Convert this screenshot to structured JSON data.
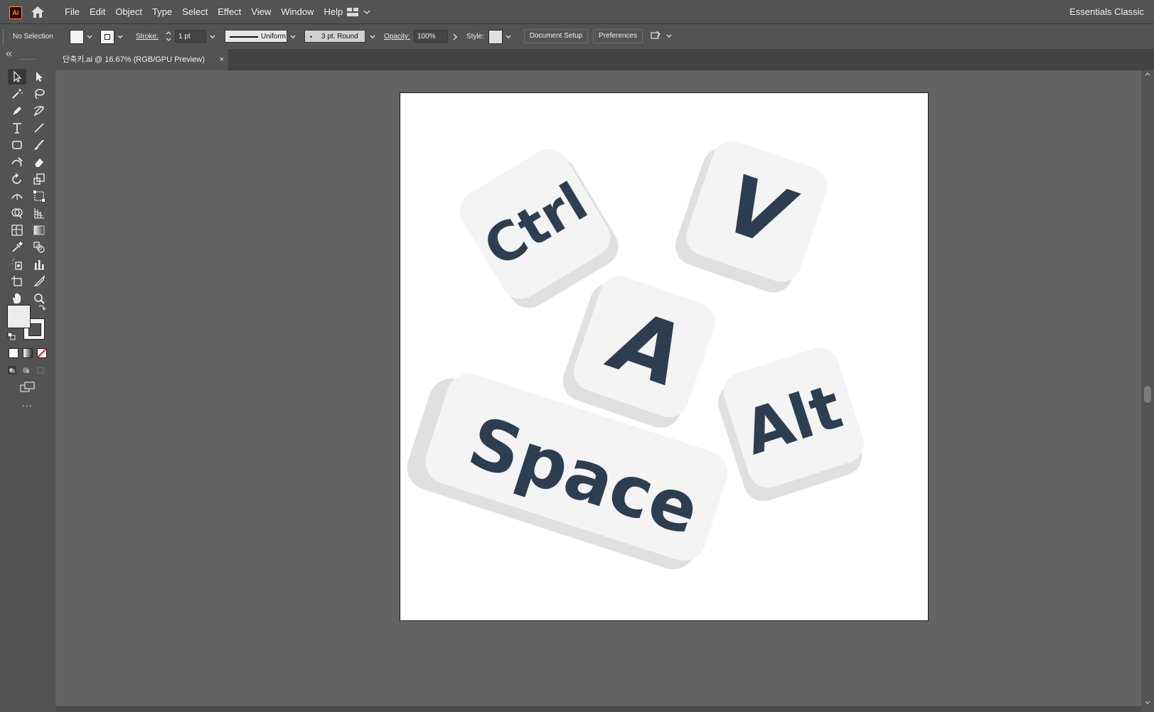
{
  "app": {
    "logo_text": "Ai",
    "workspace": "Essentials Classic"
  },
  "menu": [
    "File",
    "Edit",
    "Object",
    "Type",
    "Select",
    "Effect",
    "View",
    "Window",
    "Help"
  ],
  "control_bar": {
    "selection_status": "No Selection",
    "stroke_label": "Stroke:",
    "stroke_weight": "1 pt",
    "stroke_profile": "Uniform",
    "brush": "3 pt. Round",
    "opacity_label": "Opacity:",
    "opacity_value": "100%",
    "style_label": "Style:",
    "document_setup": "Document Setup",
    "preferences": "Preferences"
  },
  "document_tab": {
    "title": "단축키.ai @ 16.67% (RGB/GPU Preview)",
    "close": "×"
  },
  "artwork": {
    "keys": [
      {
        "name": "ctrl",
        "label": "Ctrl"
      },
      {
        "name": "v",
        "label": "V"
      },
      {
        "name": "a",
        "label": "A"
      },
      {
        "name": "alt",
        "label": "Alt"
      },
      {
        "name": "space",
        "label": "Space"
      }
    ],
    "colors": {
      "key_top": "#f4f4f4",
      "key_side": "#e0e0e0",
      "label": "#2d3e51"
    }
  },
  "toolbox": {
    "more_tools": "..."
  }
}
